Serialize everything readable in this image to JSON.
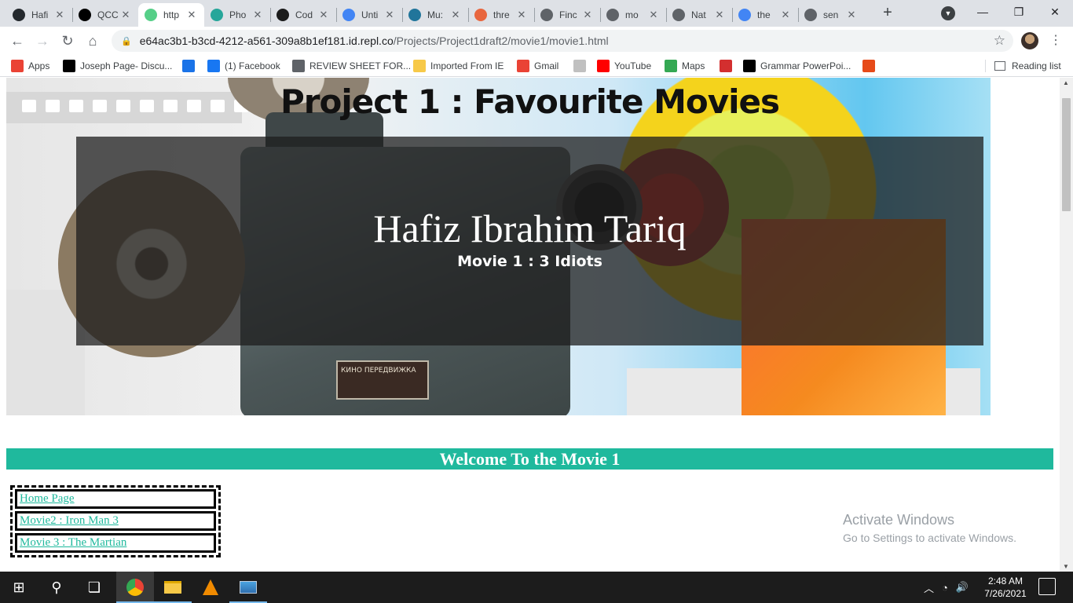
{
  "browser": {
    "tabs": [
      {
        "title": "Hafi",
        "icon": "github-icon",
        "color": "#24292e",
        "active": false
      },
      {
        "title": "QCC",
        "icon": "q-icon",
        "color": "#000000",
        "active": false
      },
      {
        "title": "http",
        "icon": "repl-icon",
        "color": "#56cf88",
        "active": true
      },
      {
        "title": "Pho",
        "icon": "pixlr-icon",
        "color": "#26a69a",
        "active": false
      },
      {
        "title": "Cod",
        "icon": "code-icon",
        "color": "#1b1b1b",
        "active": false
      },
      {
        "title": "Unti",
        "icon": "docs-icon",
        "color": "#4285f4",
        "active": false
      },
      {
        "title": "Mu:",
        "icon": "wordpress-icon",
        "color": "#21759b",
        "active": false
      },
      {
        "title": "thre",
        "icon": "cloud-icon",
        "color": "#e8663e",
        "active": false
      },
      {
        "title": "Finc",
        "icon": "globe-icon",
        "color": "#5f6368",
        "active": false
      },
      {
        "title": "mo",
        "icon": "globe-icon",
        "color": "#5f6368",
        "active": false
      },
      {
        "title": "Nat",
        "icon": "globe-icon",
        "color": "#5f6368",
        "active": false
      },
      {
        "title": "the",
        "icon": "google-icon",
        "color": "#4285f4",
        "active": false
      },
      {
        "title": "sen",
        "icon": "globe-icon",
        "color": "#5f6368",
        "active": false
      }
    ],
    "tab_close": "✕",
    "new_tab": "+",
    "window": {
      "minimize": "—",
      "maximize": "❐",
      "close": "✕"
    },
    "url_host": "e64ac3b1-b3cd-4212-a561-309a8b1ef181.id.repl.co",
    "url_path": "/Projects/Project1draft2/movie1/movie1.html",
    "nav": {
      "back": "←",
      "forward": "→",
      "reload": "↻",
      "home": "⌂"
    },
    "bookmarks": [
      {
        "label": "Apps",
        "icon": "apps-grid-icon",
        "color": "#ea4335"
      },
      {
        "label": "Joseph Page- Discu...",
        "icon": "blackboard-icon",
        "color": "#000000"
      },
      {
        "label": "",
        "icon": "k-icon",
        "color": "#1a73e8"
      },
      {
        "label": "(1) Facebook",
        "icon": "facebook-icon",
        "color": "#1877f2"
      },
      {
        "label": "REVIEW SHEET FOR...",
        "icon": "globe-icon",
        "color": "#5f6368"
      },
      {
        "label": "Imported From IE",
        "icon": "folder-icon",
        "color": "#f7c948"
      },
      {
        "label": "Gmail",
        "icon": "gmail-icon",
        "color": "#ea4335"
      },
      {
        "label": "",
        "icon": "doc-icon",
        "color": "#c0c0c0"
      },
      {
        "label": "YouTube",
        "icon": "youtube-icon",
        "color": "#ff0000"
      },
      {
        "label": "Maps",
        "icon": "maps-icon",
        "color": "#34a853"
      },
      {
        "label": "",
        "icon": "m-icon",
        "color": "#d32f2f"
      },
      {
        "label": "Grammar PowerPoi...",
        "icon": "gb-icon",
        "color": "#000000"
      },
      {
        "label": "",
        "icon": "office-icon",
        "color": "#e64a19"
      }
    ],
    "reading_list": "Reading list"
  },
  "page": {
    "hero_title": "Project 1 : Favourite Movies",
    "author": "Hafiz Ibrahim Tariq",
    "movie": "Movie 1 : 3 Idiots",
    "projector_label": "КИНО ПЕРЕДВИЖКА",
    "welcome": "Welcome To the Movie 1",
    "nav_links": [
      "Home Page",
      "Movie2 : Iron Man 3",
      "Movie 3 : The Martian"
    ],
    "accent": "#1fb99d"
  },
  "watermark": {
    "title": "Activate Windows",
    "subtitle": "Go to Settings to activate Windows."
  },
  "taskbar": {
    "time": "2:48 AM",
    "date": "7/26/2021"
  }
}
